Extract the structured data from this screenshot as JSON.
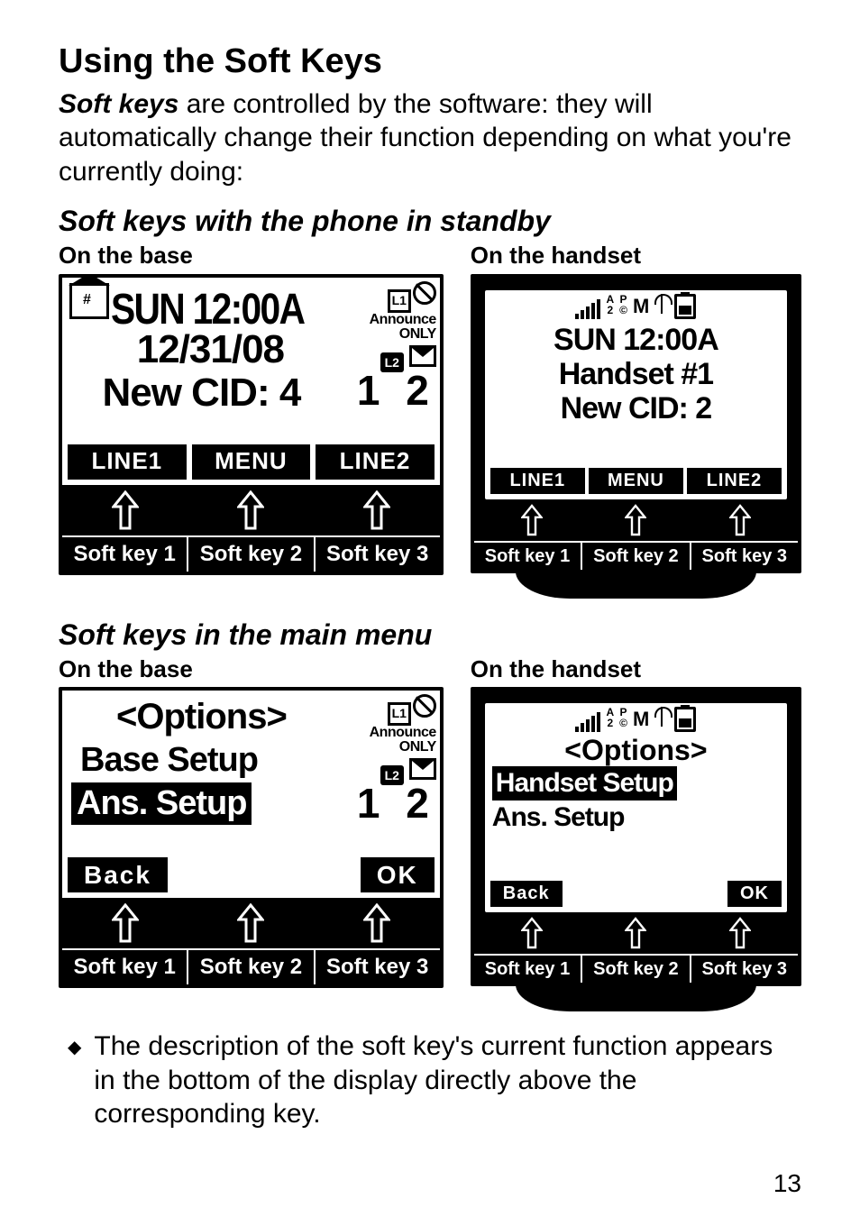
{
  "title": "Using the Soft Keys",
  "intro_em": "Soft keys",
  "intro_rest": " are controlled by the software: they will automatically change their function depending on what you're currently doing:",
  "section1": "Soft keys with the phone in standby",
  "section2": "Soft keys in the main menu",
  "on_base": "On the base",
  "on_handset": "On the handset",
  "base1": {
    "line1": "SUN 12:00A",
    "line2": "12/31/08",
    "line3": "New CID: 4",
    "announce": "Announce",
    "only": "ONLY",
    "l1box": "L1",
    "l2box": "L2",
    "bignums": "1 2",
    "soft": [
      "LINE1",
      "MENU",
      "LINE2"
    ]
  },
  "hand1": {
    "status_frac_a": "A",
    "status_frac_2": "2",
    "status_frac_p": "P",
    "status_frac_c": "©",
    "status_m": "M",
    "line1": "SUN 12:00A",
    "line2": "Handset #1",
    "line3": "New CID: 2",
    "soft": [
      "LINE1",
      "MENU",
      "LINE2"
    ]
  },
  "base2": {
    "title": "<Options>",
    "item1": "Base Setup",
    "item2": "Ans. Setup",
    "announce": "Announce",
    "only": "ONLY",
    "l1box": "L1",
    "l2box": "L2",
    "bignums": "1 2",
    "soft_left": "Back",
    "soft_right": "OK"
  },
  "hand2": {
    "title": "<Options>",
    "item1": "Handset Setup",
    "item2": "Ans. Setup",
    "soft_left": "Back",
    "soft_right": "OK"
  },
  "softkey_labels": [
    "Soft key 1",
    "Soft key 2",
    "Soft key 3"
  ],
  "hand_softkey_labels": [
    "Soft key 1",
    "Soft key 2",
    "Soft key 3"
  ],
  "bullet": "The description of the soft key's current function appears in the bottom of the display directly above the corresponding key.",
  "page": "13"
}
